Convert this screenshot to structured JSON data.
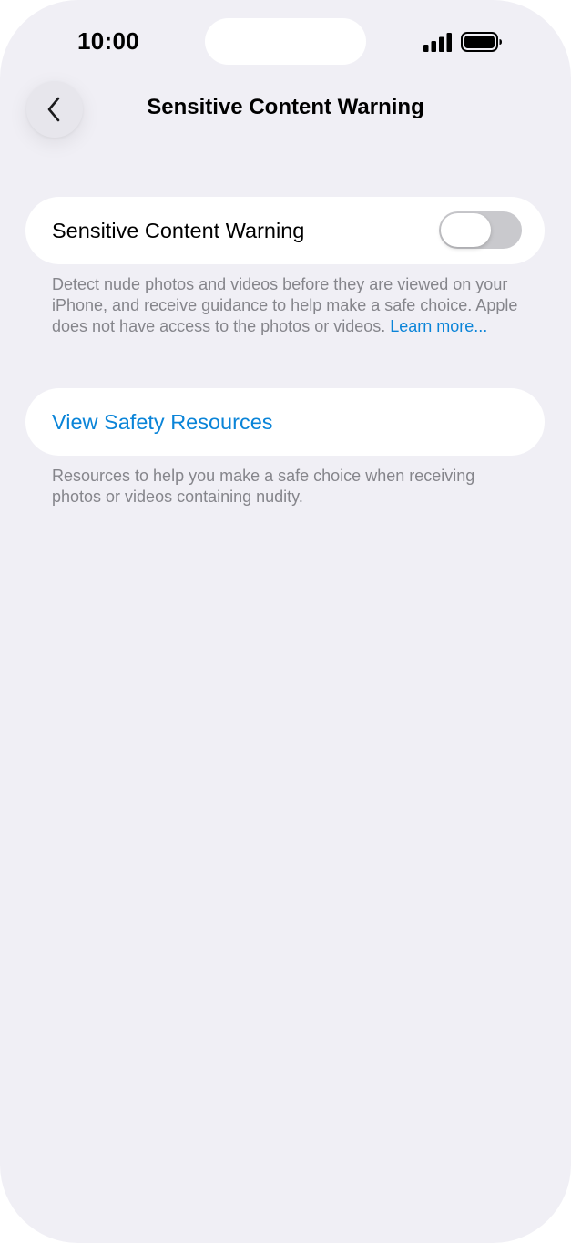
{
  "status_bar": {
    "time": "10:00",
    "signal_icon": "cellular-signal-icon",
    "battery_icon": "battery-icon"
  },
  "nav": {
    "title": "Sensitive Content Warning",
    "back_icon": "chevron-left-icon"
  },
  "settings": {
    "warning_toggle": {
      "label": "Sensitive Content Warning",
      "enabled": false
    },
    "warning_footer": {
      "text": "Detect nude photos and videos before they are viewed on your iPhone, and receive guidance to help make a safe choice. Apple does not have access to the photos or videos. ",
      "link": "Learn more..."
    },
    "safety_resources": {
      "label": "View Safety Resources",
      "footer": "Resources to help you make a safe choice when receiving photos or videos containing nudity."
    }
  },
  "colors": {
    "background": "#f0eff5",
    "accent": "#0a84d8",
    "toggle_off": "#c9c9cd",
    "secondary_text": "#85858b"
  }
}
